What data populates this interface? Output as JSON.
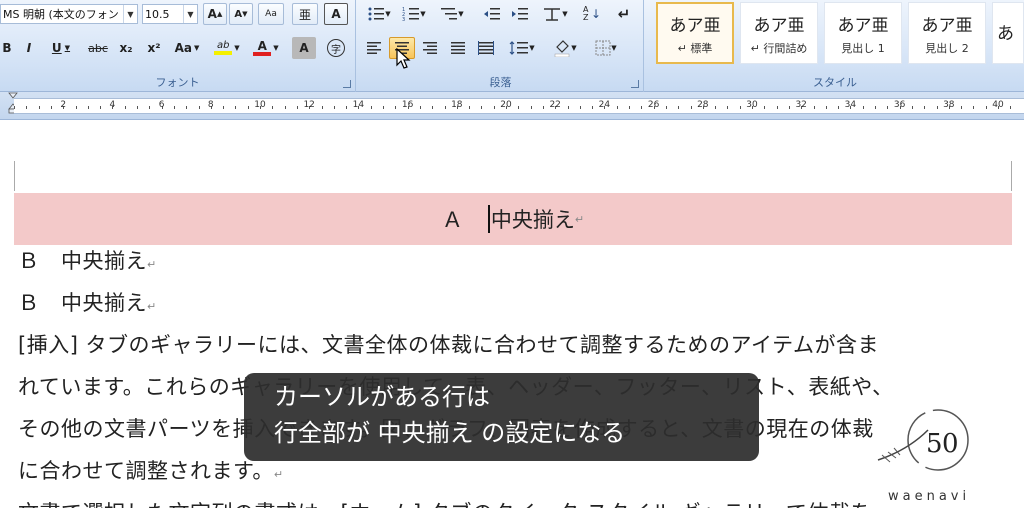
{
  "ribbon": {
    "font_group": {
      "label": "フォント",
      "font_name": "MS 明朝 (本文のフォン",
      "font_size": "10.5",
      "buttons": [
        "B",
        "I",
        "U",
        "abc",
        "x₂",
        "x²",
        "Aa"
      ],
      "grow_font": "A",
      "shrink_font": "A",
      "clear_format": "Aa",
      "phonetic": "亜",
      "char_border": "A",
      "highlight_label": "ab",
      "font_color_label": "A",
      "char_shading": "A",
      "enclosed_char": "字"
    },
    "paragraph_group": {
      "label": "段落",
      "sort_label": "A Z"
    },
    "style_group": {
      "label": "スタイル",
      "styles": [
        {
          "sample": "あア亜",
          "name": "↵ 標準"
        },
        {
          "sample": "あア亜",
          "name": "↵ 行間詰め"
        },
        {
          "sample": "あア亜",
          "name": "見出し 1"
        },
        {
          "sample": "あア亜",
          "name": "見出し 2"
        },
        {
          "sample": "あ",
          "name": ""
        }
      ]
    }
  },
  "ruler": {
    "labels": [
      "2",
      "4",
      "6",
      "8",
      "10",
      "12",
      "14",
      "16",
      "18",
      "20",
      "22",
      "24",
      "26",
      "28",
      "30",
      "32",
      "34",
      "36",
      "38",
      "40"
    ]
  },
  "document": {
    "line_a": "Ａ　中央揃え",
    "line_b1": "Ｂ　中央揃え",
    "line_b2": "Ｂ　中央揃え",
    "para1_line1": "[挿入] タブのギャラリーには、文書全体の体裁に合わせて調整するためのアイテムが含ま",
    "para1_line2": "れています。これらのギャラリーを使用して、表、ヘッダー、フッター、リスト、表紙や、",
    "para1_line3": "その他の文書パーツを挿入できます。図、グラフ、図表を作成すると、文書の現在の体裁",
    "para1_line4": "に合わせて調整されます。",
    "para2_line1": "文書で選択した文字列の書式は、[ホーム] タブのクイック スタイル ギャラリーで体裁を",
    "paragraph_mark": "↵"
  },
  "caption": {
    "line1": "カーソルがある行は",
    "line2": "行全部が 中央揃え の設定になる"
  },
  "logo": {
    "text": "waenavi",
    "number": "50"
  },
  "colors": {
    "highlight_row": "#f3c9c9",
    "ribbon_bg": "#d7e5f7",
    "active_button": "#f7c45a"
  }
}
